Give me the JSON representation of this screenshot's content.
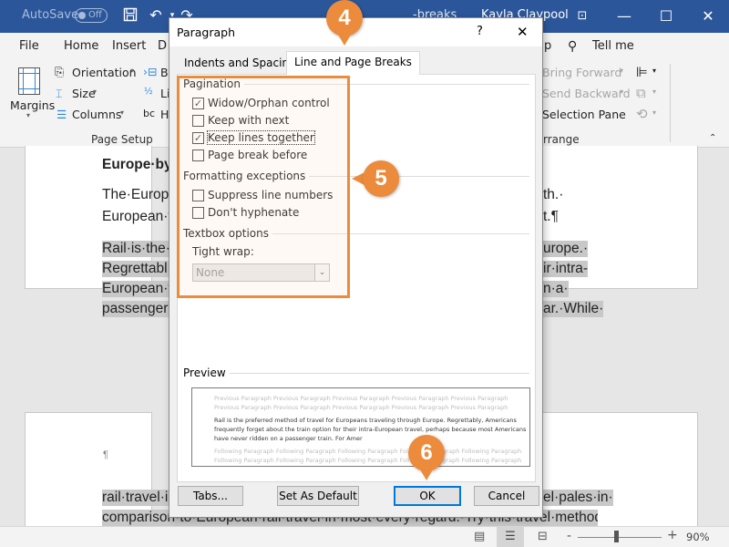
{
  "titlebar": {
    "autosave_label": "AutoSave",
    "autosave_state": "Off",
    "doc_title_fragment": "-breaks",
    "user_name": "Kayla Claypool"
  },
  "ribbon": {
    "tabs": [
      "File",
      "Home",
      "Insert",
      "D",
      "p",
      "Tell me"
    ],
    "tell_me": "Tell me",
    "page_setup": {
      "margins": "Margins",
      "orientation": "Orientation",
      "size": "Size",
      "columns": "Columns",
      "breaks_fragment": "B",
      "line_numbers_fragment": "Li",
      "hyphenation_fragment": "H",
      "group_label": "Page Setup"
    },
    "arrange": {
      "bring_forward": "Bring Forward",
      "send_backward": "Send Backward",
      "selection_pane": "Selection Pane",
      "group_label_fragment": "rrange"
    }
  },
  "document": {
    "heading_fragment": "Europe·by·",
    "para1_line1_left": "The·Europe",
    "para1_line1_right": "th.·",
    "para1_line2_left": "European·t",
    "para1_line2_right": "t.¶",
    "para2_lines_left": [
      "Rail·is·the·p",
      "Regrettabl",
      "European·t",
      "passenger·"
    ],
    "para2_lines_right": [
      "urope.·",
      "ir·intra-",
      "n·a·",
      "ar.·While·"
    ],
    "page2_pilcrow": "¶",
    "page2_line1_left": "rail·travel·i",
    "page2_line1_right": "el·pales·in·",
    "page2_line2": "comparison·to·European·rail·travel·in·most·every·regard.·Try·this·travel·method·"
  },
  "statusbar": {
    "zoom_level": "90%",
    "zoom_minus": "-",
    "zoom_plus": "+",
    "zoom_percent_value": 90
  },
  "dialog": {
    "title": "Paragraph",
    "help": "?",
    "close": "✕",
    "tabs": [
      {
        "label": "Indents and Spacing",
        "active": false
      },
      {
        "label": "Line and Page Breaks",
        "active": true
      }
    ],
    "pagination": {
      "label": "Pagination",
      "options": [
        {
          "label": "Widow/Orphan control",
          "checked": true
        },
        {
          "label": "Keep with next",
          "checked": false
        },
        {
          "label": "Keep lines together",
          "checked": true
        },
        {
          "label": "Page break before",
          "checked": false
        }
      ]
    },
    "formatting_exceptions": {
      "label": "Formatting exceptions",
      "options": [
        {
          "label": "Suppress line numbers",
          "checked": false
        },
        {
          "label": "Don't hyphenate",
          "checked": false
        }
      ]
    },
    "textbox_options": {
      "label": "Textbox options",
      "tight_wrap_label": "Tight wrap:",
      "tight_wrap_value": "None"
    },
    "preview": {
      "label": "Preview",
      "previous_lines": [
        "Previous Paragraph Previous Paragraph Previous Paragraph Previous Paragraph Previous Paragraph",
        "Previous Paragraph Previous Paragraph Previous Paragraph Previous Paragraph Previous Paragraph"
      ],
      "sample_lines": [
        "Rail is the preferred method of travel for Europeans traveling through Europe. Regrettably, Americans",
        "frequently forget about the train option for their intra-European travel, perhaps because most Americans",
        "have never ridden on a passenger train. For Amer"
      ],
      "following_lines": [
        "Following Paragraph Following Paragraph Following Paragraph Following Paragraph Following Paragraph",
        "Following Paragraph Following Paragraph Following Paragraph Following Paragraph Following Paragraph"
      ]
    },
    "buttons": {
      "tabs": "Tabs...",
      "set_as_default": "Set As Default",
      "ok": "OK",
      "cancel": "Cancel"
    }
  },
  "callouts": {
    "step4": "4",
    "step5": "5",
    "step6": "6",
    "color": "#ec8b3b"
  }
}
